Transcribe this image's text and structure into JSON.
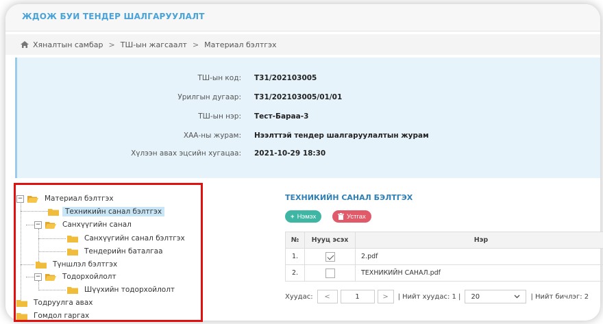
{
  "app": {
    "title": "ЖДОЖ БУИ ТЕНДЕР ШАЛГАРУУЛАЛТ"
  },
  "breadcrumb": {
    "items": [
      "Хяналтын самбар",
      "ТШ-ын жагсаалт",
      "Материал бэлтгэх"
    ],
    "separator": ">"
  },
  "info": {
    "rows": [
      {
        "label": "ТШ-ын код:",
        "value": "Т31/202103005"
      },
      {
        "label": "Урилгын дугаар:",
        "value": "Т31/202103005/01/01"
      },
      {
        "label": "ТШ-ын нэр:",
        "value": "Тест-Бараа-3"
      },
      {
        "label": "ХАА-ны журам:",
        "value": "Нээлттэй тендер шалгаруулалтын журам"
      },
      {
        "label": "Хүлээн авах эцсийн хугацаа:",
        "value": "2021-10-29 18:30"
      }
    ]
  },
  "tree": {
    "nodes": [
      {
        "label": "Материал бэлтгэх",
        "expanded": true
      },
      {
        "label": "Техникийн санал бэлтгэх",
        "selected": true
      },
      {
        "label": "Санхүүгийн санал",
        "expanded": true
      },
      {
        "label": "Санхүүгийн санал бэлтгэх"
      },
      {
        "label": "Тендерийн баталгаа"
      },
      {
        "label": "Түншлэл бэлтгэх"
      },
      {
        "label": "Тодорхойлолт",
        "expanded": true
      },
      {
        "label": "Шүүхийн тодорхойлолт"
      },
      {
        "label": "Тодруулга авах"
      },
      {
        "label": "Гомдол гаргах"
      }
    ],
    "toggle_minus": "−"
  },
  "panel": {
    "title": "ТЕХНИКИЙН САНАЛ БЭЛТГЭХ",
    "add_button": "Нэмэх",
    "delete_button": "Устгах",
    "columns": {
      "num": "№",
      "secret": "Нууц эсэх",
      "name": "Нэр"
    },
    "rows": [
      {
        "num": "1.",
        "secret": true,
        "name": "2.pdf"
      },
      {
        "num": "2.",
        "secret": false,
        "name": "ТЕХНИКИЙН САНАЛ.pdf"
      }
    ]
  },
  "pager": {
    "label": "Хуудас:",
    "prev": "<",
    "page": "1",
    "next": ">",
    "total_pages": "| Нийт хуудас: 1 |",
    "page_size": "20",
    "total_records": "| Нийт бичлэг: 2"
  },
  "colors": {
    "accent": "#4aa3d8",
    "info_bg": "#e6f3fb",
    "add": "#3fb5a3",
    "delete": "#e05a6a",
    "highlight": "#e01010"
  }
}
